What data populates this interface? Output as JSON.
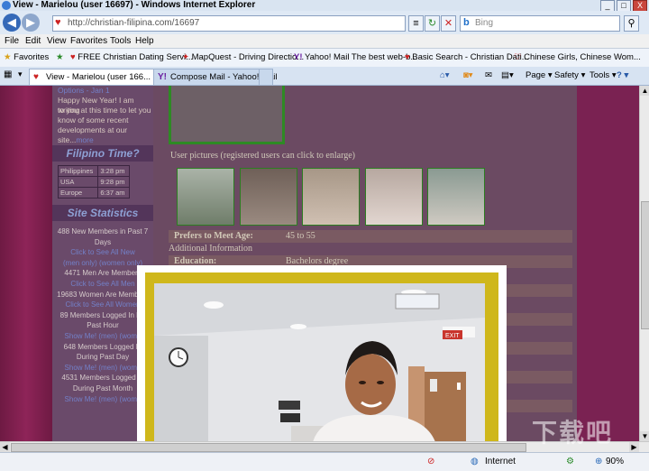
{
  "window": {
    "title": "View - Marielou (user 16697) - Windows Internet Explorer",
    "min": "_",
    "max": "□",
    "close": "X"
  },
  "nav": {
    "back": "◀",
    "forward": "▶",
    "url": "http://christian-filipina.com/16697",
    "search_placeholder": "Bing",
    "compat": "≡",
    "refresh": "↻",
    "stop": "✕",
    "search_go": "⚲"
  },
  "menu": [
    "File",
    "Edit",
    "View",
    "Favorites",
    "Tools",
    "Help"
  ],
  "favorites": {
    "label": "Favorites",
    "items": [
      "FREE Christian Dating Servi...",
      "MapQuest - Driving Directio...",
      "Yahoo! Mail The best web-b...",
      "Basic Search - Christian Dati...",
      "Chinese Girls, Chinese Wom..."
    ]
  },
  "tabs": [
    {
      "label": "View - Marielou (user 166...",
      "close": "x"
    },
    {
      "label": "Compose Mail - Yahoo! Mail"
    }
  ],
  "commands": {
    "page": "Page ▾",
    "safety": "Safety ▾",
    "tools": "Tools ▾",
    "help": "? ▾"
  },
  "sidebar": {
    "news": {
      "link": "Options - Jan 1",
      "text": [
        "Happy New Year! I am writing",
        "to you at this time to let you",
        "know of some recent",
        "developments at our"
      ],
      "tail": "site...",
      "more": "more"
    },
    "time_header": "Filipino Time?",
    "times": [
      {
        "place": "Philippines",
        "time": "3:28 pm"
      },
      {
        "place": "USA",
        "time": "9:28 pm"
      },
      {
        "place": "Europe",
        "time": "6:37 am"
      }
    ],
    "stats_header": "Site Statistics",
    "stats": [
      {
        "text": "488 New Members in Past 7",
        "link": false
      },
      {
        "text": "Days",
        "link": false
      },
      {
        "text": "Click to See All New",
        "link": true
      },
      {
        "text": "(men only) (women only)",
        "link": true
      },
      {
        "text": "4471 Men Are Members",
        "link": false
      },
      {
        "text": "Click to See All Men",
        "link": true
      },
      {
        "text": "19683 Women Are Members",
        "link": false
      },
      {
        "text": "Click to See All Women",
        "link": true
      },
      {
        "text": "89 Members Logged In Du",
        "link": false
      },
      {
        "text": "Past Hour",
        "link": false
      },
      {
        "text": "Show Me! (men) (wome",
        "link": true
      },
      {
        "text": "648 Members Logged In",
        "link": false
      },
      {
        "text": "During Past Day",
        "link": false
      },
      {
        "text": "Show Me! (men) (wome",
        "link": true
      },
      {
        "text": "4531 Members Logged In",
        "link": false
      },
      {
        "text": "During Past Month",
        "link": false
      },
      {
        "text": "Show Me! (men) (wome",
        "link": true
      }
    ]
  },
  "profile": {
    "pictures_label": "User pictures (registered users can click to enlarge)",
    "prefers_label": "Prefers to Meet Age:",
    "prefers_value": "45 to 55",
    "additional_label": "Additional Information",
    "education_label": "Education:",
    "education_value": "Bachelors degree"
  },
  "lightbox": {
    "exit_sign": "EXIT"
  },
  "status": {
    "zone": "Internet",
    "zoom": "90%"
  },
  "watermark": "下载吧"
}
